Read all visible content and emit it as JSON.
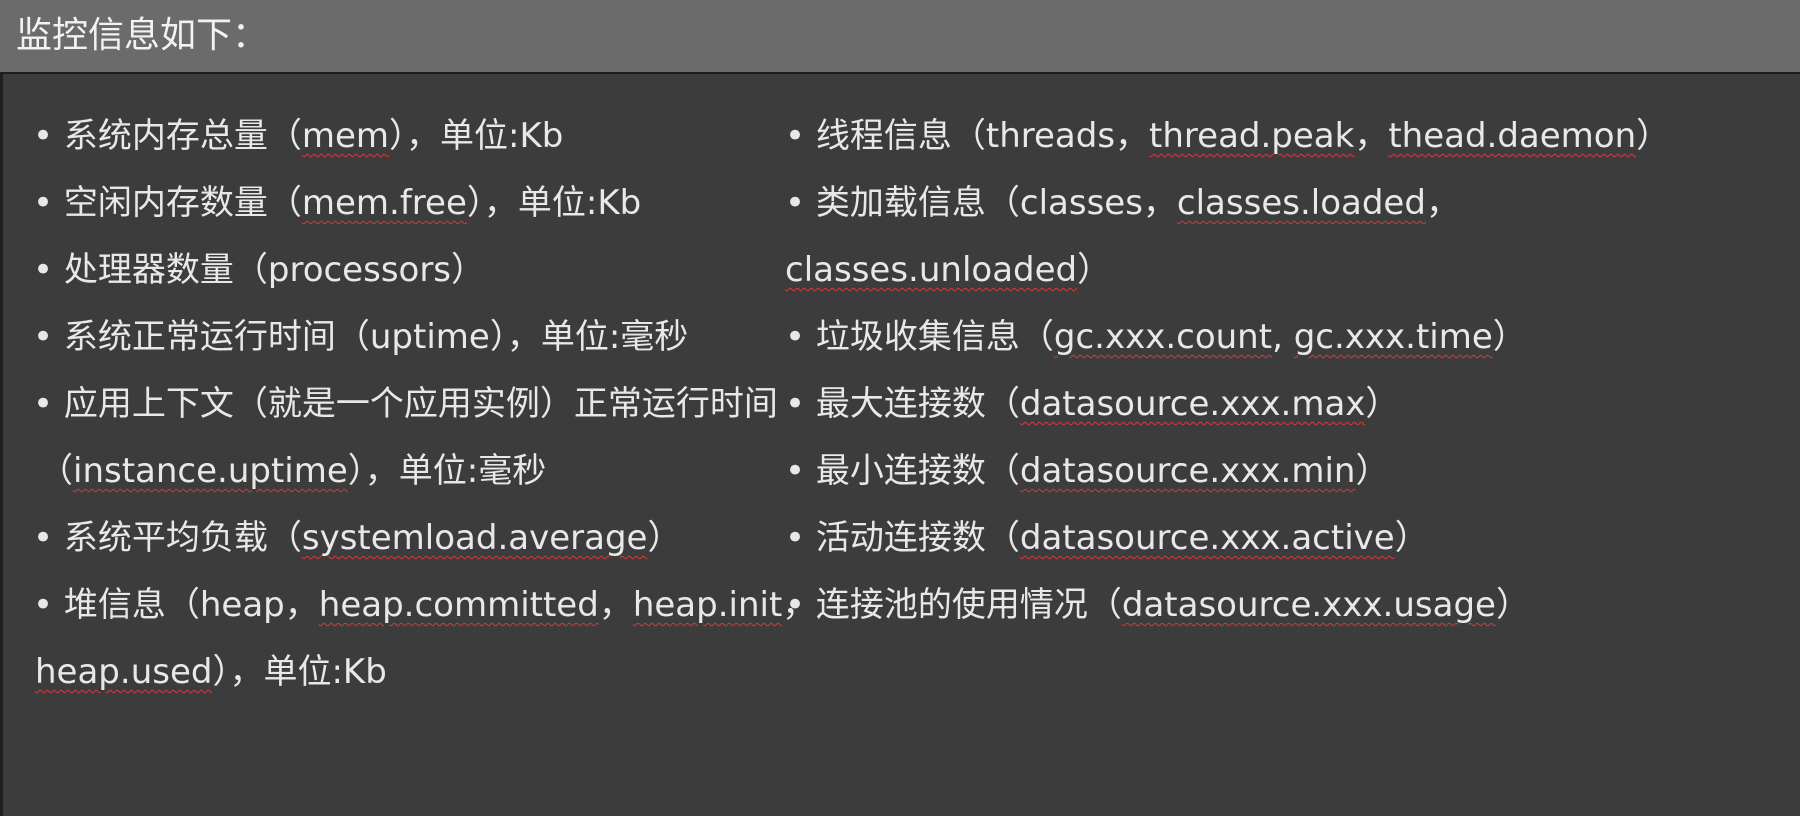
{
  "header": {
    "title": "监控信息如下："
  },
  "left_column": {
    "item1": {
      "bullet": "•",
      "pre": "系统内存总量（",
      "code": "mem",
      "post": "），单位:Kb"
    },
    "item2": {
      "bullet": "•",
      "pre": "空闲内存数量（",
      "code": "mem.free",
      "post": "），单位:Kb"
    },
    "item3": {
      "bullet": "•",
      "text": "处理器数量（processors）"
    },
    "item4": {
      "bullet": "•",
      "text": "系统正常运行时间（uptime），单位:毫秒"
    },
    "item5": {
      "bullet": "•",
      "line1": "应用上下文（就是一个应用实例）正常运行时间",
      "line2_pre": "（",
      "line2_code": "instance.uptime",
      "line2_post": "），单位:毫秒"
    },
    "item6": {
      "bullet": "•",
      "pre": "系统平均负载（",
      "code": "systemload.average",
      "post": "）"
    },
    "item7": {
      "bullet": "•",
      "line1_pre": "堆信息（heap，",
      "line1_code1": "heap.committed",
      "line1_sep": "，",
      "line1_code2": "heap.init",
      "line1_post": "，",
      "line2_code": "heap.used",
      "line2_post": "），单位:Kb"
    }
  },
  "right_column": {
    "item1": {
      "bullet": "•",
      "pre": "线程信息（threads，",
      "code1": "thread.peak",
      "sep": "，",
      "code2": "thead.daemon",
      "post": "）"
    },
    "item2": {
      "bullet": "•",
      "line1_pre": "类加载信息（classes，",
      "line1_code": "classes.loaded",
      "line1_post": "，",
      "line2_code": "classes.unloaded",
      "line2_post": "）"
    },
    "item3": {
      "bullet": "•",
      "pre": "垃圾收集信息（",
      "code1": "gc.xxx.count",
      "sep": ", ",
      "code2": "gc.xxx.time",
      "post": "）"
    },
    "item4": {
      "bullet": "•",
      "pre": "最大连接数（",
      "code": "datasource.xxx.max",
      "post": "）"
    },
    "item5": {
      "bullet": "•",
      "pre": "最小连接数（",
      "code": "datasource.xxx.min",
      "post": "）"
    },
    "item6": {
      "bullet": "•",
      "pre": "活动连接数（",
      "code": "datasource.xxx.active",
      "post": "）"
    },
    "item7": {
      "bullet": "•",
      "pre": "连接池的使用情况（",
      "code": "datasource.xxx.usage",
      "post": "）"
    }
  }
}
